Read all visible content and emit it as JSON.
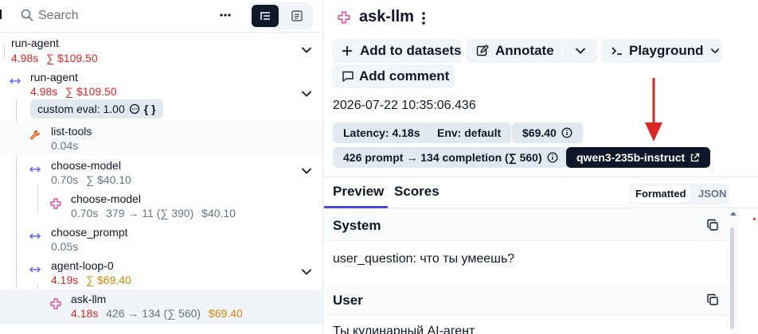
{
  "search": {
    "placeholder": "Search"
  },
  "tree": [
    {
      "name": "run-agent",
      "latency": "4.98s",
      "cost": "∑ $109.50"
    },
    {
      "name": "run-agent",
      "latency": "4.98s",
      "cost": "∑ $109.50",
      "eval": "custom eval: 1.00",
      "eval_icon_text": "{ }"
    },
    {
      "name": "list-tools",
      "latency": "0.04s"
    },
    {
      "name": "choose-model",
      "latency": "0.70s",
      "cost": "∑ $40.10"
    },
    {
      "name": "choose-model",
      "latency": "0.70s",
      "tokens": "379 → 11 (∑ 390)",
      "cost": "$40.10"
    },
    {
      "name": "choose_prompt",
      "latency": "0.05s"
    },
    {
      "name": "agent-loop-0",
      "latency": "4.19s",
      "cost": "∑ $69.40"
    },
    {
      "name": "ask-llm",
      "latency": "4.18s",
      "tokens": "426 → 134 (∑ 560)",
      "cost": "$69.40"
    }
  ],
  "detail": {
    "title": "ask-llm",
    "actions": {
      "add_to_datasets": "Add to datasets",
      "annotate": "Annotate",
      "playground": "Playground",
      "add_comment": "Add comment"
    },
    "timestamp": "2026-07-22 10:35:06.436",
    "badges": {
      "latency": "Latency: 4.18s",
      "env": "Env: default",
      "cost": "$69.40",
      "tokens": "426 prompt → 134 completion (∑ 560)",
      "model": "qwen3-235b-instruct"
    },
    "tabs": {
      "preview": "Preview",
      "scores": "Scores"
    },
    "format_toggle": {
      "formatted": "Formatted",
      "json": "JSON"
    },
    "sections": [
      {
        "title": "System",
        "body": "user_question: что ты умеешь?"
      },
      {
        "title": "User",
        "body": "Ты кулинарный AI-агент"
      }
    ]
  },
  "colors": {
    "accent": "#4f46e5",
    "latency_warn": "#dc2626",
    "cost": "#ca8a04",
    "span_purple": "#6366f1",
    "generation_pink": "#ec4899",
    "tool_orange": "#ea580c"
  }
}
